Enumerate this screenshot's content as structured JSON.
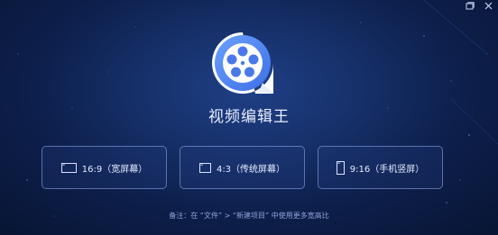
{
  "app": {
    "title": "视频编辑王"
  },
  "icons": {
    "logo": "film-reel-icon",
    "window_restore": "window-restore-icon",
    "window_close": "close-icon",
    "landscape": "landscape-screen-icon",
    "standard": "standard-screen-icon",
    "portrait": "portrait-phone-icon"
  },
  "ratio_buttons": [
    {
      "label": "16:9（宽屏幕）"
    },
    {
      "label": "4:3（传统屏幕）"
    },
    {
      "label": "9:16（手机竖屏）"
    }
  ],
  "footnote": "备注：在 “文件” > “新建项目” 中使用更多宽高比",
  "colors": {
    "background": "#0d1f4b",
    "logo_blue": "#4f7ff0",
    "logo_white": "#ffffff",
    "button_border": "#96afeb"
  }
}
